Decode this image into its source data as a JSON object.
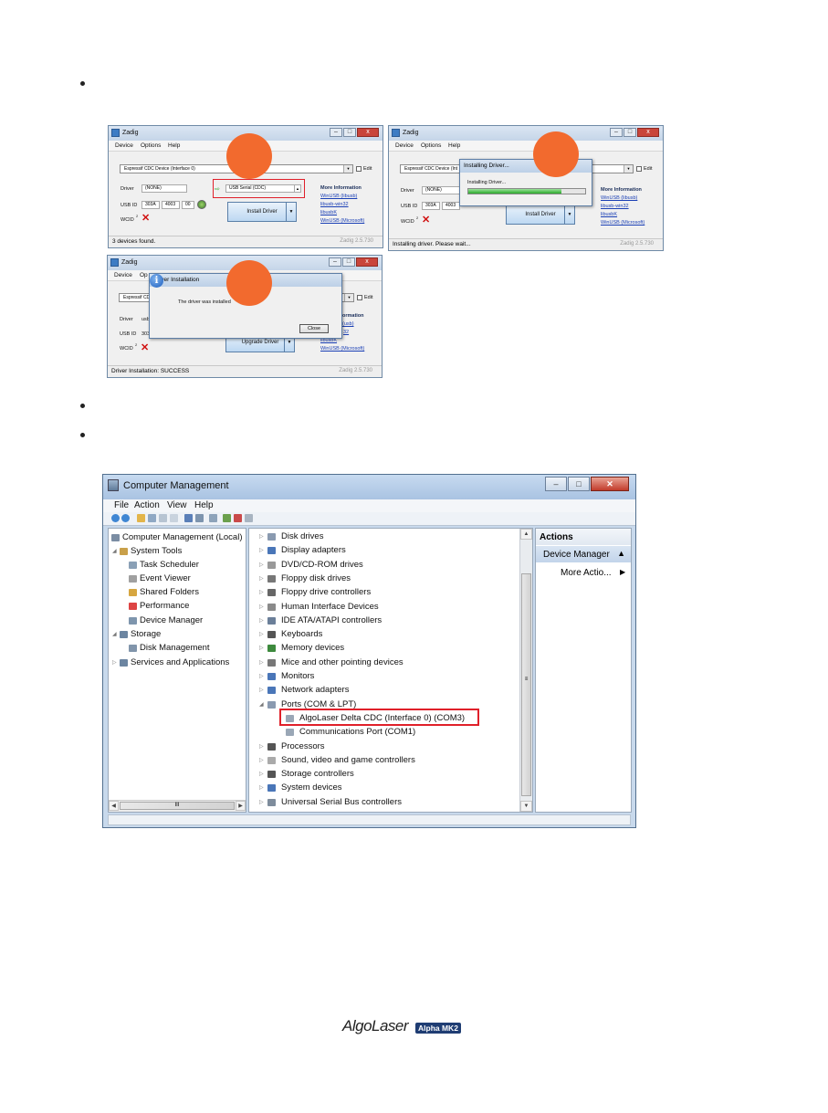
{
  "zadig_windows": [
    {
      "title": "Zadig",
      "menu": [
        "Device",
        "Options",
        "Help"
      ],
      "device": "Espressif CDC Device (Interface 0)",
      "edit": "Edit",
      "driver_label": "Driver",
      "driver_current": "(NONE)",
      "driver_target": "USB Serial (CDC)",
      "usbid_label": "USB ID",
      "usbid": [
        "303A",
        "4003",
        "00"
      ],
      "wcid_label": "WCID",
      "wcid_sup": "2",
      "action": "Install Driver",
      "more_info": "More Information",
      "links": [
        "WinUSB (libusb)",
        "libusb-win32",
        "libusbK",
        "WinUSB (Microsoft)"
      ],
      "status": "3 devices found.",
      "version": "Zadig 2.5.730"
    },
    {
      "title": "Zadig",
      "menu": [
        "Device",
        "Options",
        "Help"
      ],
      "device": "Espressif CDC Device (Int",
      "edit": "Edit",
      "driver_label": "Driver",
      "driver_current": "(NONE)",
      "usbid_label": "USB ID",
      "usbid": [
        "303A",
        "4003"
      ],
      "wcid_label": "WCID",
      "wcid_sup": "2",
      "action": "Install Driver",
      "more_info": "More Information",
      "links": [
        "WinUSB (libusb)",
        "libusb-win32",
        "libusbK",
        "WinUSB (Microsoft)"
      ],
      "dialog_title": "Installing Driver...",
      "dialog_text": "Installing Driver...",
      "progress": 0.8,
      "status": "Installing driver. Please wait...",
      "version": "Zadig 2.5.730"
    },
    {
      "title": "Zadig",
      "menu": [
        "Device",
        "Op"
      ],
      "device": "Espressif CD",
      "edit": "Edit",
      "driver_label": "Driver",
      "driver_current": "usb",
      "usbid_label": "USB ID",
      "usbid": [
        "303"
      ],
      "wcid_label": "WCID",
      "wcid_sup": "2",
      "action": "Upgrade Driver",
      "more_info": "ormation",
      "links": [
        "(usb)",
        "32",
        "libusbK",
        "WinUSB (Microsoft)"
      ],
      "dialog_title": "Driver Installation",
      "dialog_text": "The driver was installed",
      "dialog_button": "Close",
      "status": "Driver Installation: SUCCESS",
      "version": "Zadig 2.5.730"
    }
  ],
  "computer_management": {
    "title": "Computer Management",
    "menu": [
      "File",
      "Action",
      "View",
      "Help"
    ],
    "left_tree": [
      {
        "label": "Computer Management (Local)",
        "indent": 0
      },
      {
        "label": "System Tools",
        "indent": 1
      },
      {
        "label": "Task Scheduler",
        "indent": 2
      },
      {
        "label": "Event Viewer",
        "indent": 2
      },
      {
        "label": "Shared Folders",
        "indent": 2
      },
      {
        "label": "Performance",
        "indent": 2
      },
      {
        "label": "Device Manager",
        "indent": 2
      },
      {
        "label": "Storage",
        "indent": 1
      },
      {
        "label": "Disk Management",
        "indent": 2
      },
      {
        "label": "Services and Applications",
        "indent": 1
      }
    ],
    "device_tree": [
      "Disk drives",
      "Display adapters",
      "DVD/CD-ROM drives",
      "Floppy disk drives",
      "Floppy drive controllers",
      "Human Interface Devices",
      "IDE ATA/ATAPI controllers",
      "Keyboards",
      "Memory devices",
      "Mice and other pointing devices",
      "Monitors",
      "Network adapters",
      "Ports (COM & LPT)",
      "AlgoLaser Delta CDC (Interface 0) (COM3)",
      "Communications Port (COM1)",
      "Processors",
      "Sound, video and game controllers",
      "Storage controllers",
      "System devices",
      "Universal Serial Bus controllers"
    ],
    "actions": {
      "header": "Actions",
      "section": "Device Manager",
      "more": "More Actio..."
    }
  },
  "footer": {
    "brand": "AlgoLaser",
    "badge": "Alpha MK2"
  }
}
